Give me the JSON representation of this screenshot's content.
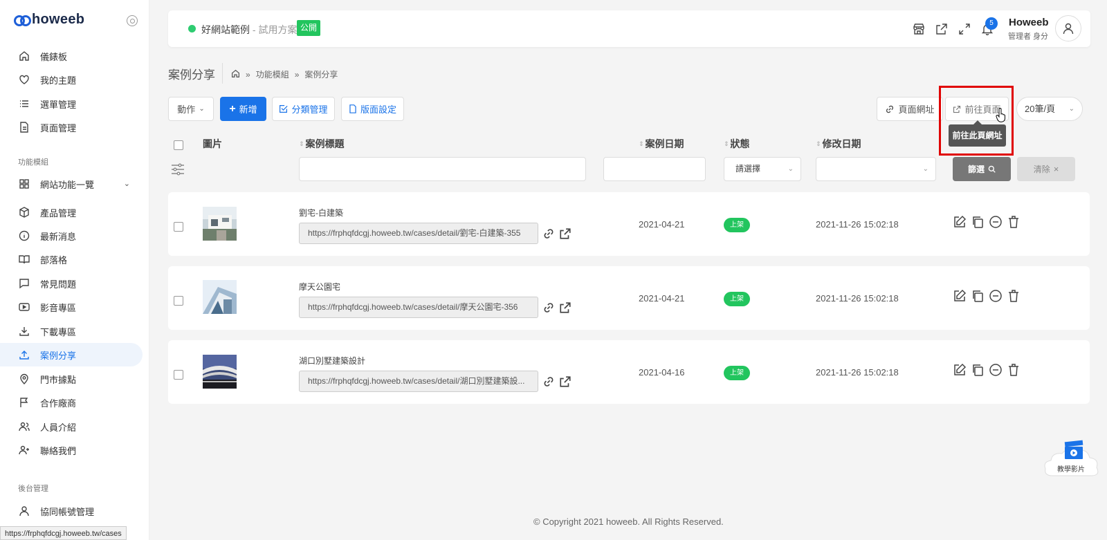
{
  "sidebar": {
    "logo": "howeeb",
    "items_top": [
      {
        "label": "儀錶板",
        "icon": "home-icon"
      },
      {
        "label": "我的主題",
        "icon": "heart-icon"
      },
      {
        "label": "選單管理",
        "icon": "list-icon"
      },
      {
        "label": "頁面管理",
        "icon": "document-icon"
      }
    ],
    "section_modules": "功能模組",
    "module_group": "網站功能一覽",
    "items_modules": [
      {
        "label": "產品管理",
        "icon": "box-icon"
      },
      {
        "label": "最新消息",
        "icon": "info-icon"
      },
      {
        "label": "部落格",
        "icon": "book-icon"
      },
      {
        "label": "常見問題",
        "icon": "chat-icon"
      },
      {
        "label": "影音專區",
        "icon": "video-icon"
      },
      {
        "label": "下載專區",
        "icon": "download-icon"
      },
      {
        "label": "案例分享",
        "icon": "upload-icon",
        "active": true
      },
      {
        "label": "門市據點",
        "icon": "location-pin-icon"
      },
      {
        "label": "合作廠商",
        "icon": "flag-icon"
      },
      {
        "label": "人員介紹",
        "icon": "users-icon"
      },
      {
        "label": "聯絡我們",
        "icon": "user-plus-icon"
      }
    ],
    "section_backend": "後台管理",
    "items_backend": [
      {
        "label": "協同帳號管理",
        "icon": "user-icon"
      }
    ],
    "status_url": "https://frphqfdcgj.howeeb.tw/cases"
  },
  "topbar": {
    "site_name": "好網站範例",
    "site_plan": " - 試用方案",
    "public_badge": "公開",
    "notification_count": "5",
    "user_name": "Howeeb",
    "user_role": "管理者 身分"
  },
  "page": {
    "title": "案例分享",
    "breadcrumb": [
      "功能模組",
      "案例分享"
    ]
  },
  "toolbar": {
    "action_label": "動作",
    "add_label": "新增",
    "category_label": "分類管理",
    "layout_label": "版面設定",
    "page_url_label": "頁面網址",
    "goto_page_label": "前往頁面",
    "tooltip": "前往此頁網址",
    "per_page": "20筆/頁"
  },
  "table": {
    "headers": {
      "image": "圖片",
      "title": "案例標題",
      "date": "案例日期",
      "status": "狀態",
      "modified": "修改日期"
    },
    "status_select_placeholder": "請選擇",
    "filter_label": "篩選",
    "clear_label": "清除",
    "rows": [
      {
        "title": "劉宅-白建築",
        "url": "https://frphqfdcgj.howeeb.tw/cases/detail/劉宅-白建築-355",
        "date": "2021-04-21",
        "status": "上架",
        "modified": "2021-11-26 15:02:18"
      },
      {
        "title": "摩天公園宅",
        "url": "https://frphqfdcgj.howeeb.tw/cases/detail/摩天公園宅-356",
        "date": "2021-04-21",
        "status": "上架",
        "modified": "2021-11-26 15:02:18"
      },
      {
        "title": "湖口別墅建築設計",
        "url": "https://frphqfdcgj.howeeb.tw/cases/detail/湖口別墅建築設...",
        "date": "2021-04-16",
        "status": "上架",
        "modified": "2021-11-26 15:02:18"
      }
    ]
  },
  "footer": {
    "copyright": "© Copyright 2021 howeeb. All Rights Reserved."
  },
  "widget": {
    "video_label": "教學影片"
  },
  "colors": {
    "primary": "#1a73e8",
    "success": "#22c55e",
    "highlight": "#e00000"
  }
}
